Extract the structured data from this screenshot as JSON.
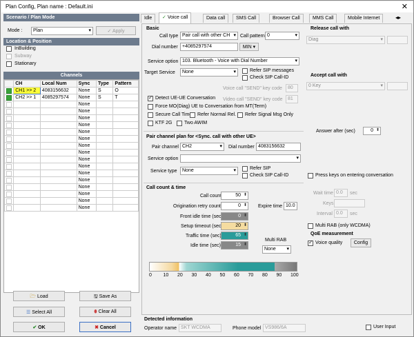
{
  "window": {
    "title": "Plan Config, Plan name : Default.ini",
    "close": "✕"
  },
  "left": {
    "section1": "Scenario / Plan Mode",
    "mode_label": "Mode :",
    "mode_value": "Plan",
    "apply": "Apply",
    "section2": "Location & Position",
    "location": [
      {
        "label": "InBuilding",
        "checked": false,
        "disabled": false
      },
      {
        "label": "Subway",
        "checked": false,
        "disabled": true
      },
      {
        "label": "Stationary",
        "checked": false,
        "disabled": false
      }
    ],
    "channels_title": "Channels",
    "columns": [
      "CH",
      "Local Num",
      "Sync",
      "Type",
      "Pattern"
    ],
    "rows": [
      {
        "checked": true,
        "ch": "CH1 >> 2",
        "num": "4083156632",
        "sync": "None",
        "type": "S",
        "pattern": "O",
        "highlight": true
      },
      {
        "checked": true,
        "ch": "CH2 >> 1",
        "num": "4085297574",
        "sync": "None",
        "type": "S",
        "pattern": "T",
        "highlight": false
      },
      {
        "checked": false,
        "ch": "",
        "num": "",
        "sync": "None",
        "type": "",
        "pattern": ""
      },
      {
        "checked": false,
        "ch": "",
        "num": "",
        "sync": "None",
        "type": "",
        "pattern": ""
      },
      {
        "checked": false,
        "ch": "",
        "num": "",
        "sync": "None",
        "type": "",
        "pattern": ""
      },
      {
        "checked": false,
        "ch": "",
        "num": "",
        "sync": "None",
        "type": "",
        "pattern": ""
      },
      {
        "checked": false,
        "ch": "",
        "num": "",
        "sync": "None",
        "type": "",
        "pattern": ""
      },
      {
        "checked": false,
        "ch": "",
        "num": "",
        "sync": "None",
        "type": "",
        "pattern": ""
      },
      {
        "checked": false,
        "ch": "",
        "num": "",
        "sync": "None",
        "type": "",
        "pattern": ""
      },
      {
        "checked": false,
        "ch": "",
        "num": "",
        "sync": "None",
        "type": "",
        "pattern": ""
      },
      {
        "checked": false,
        "ch": "",
        "num": "",
        "sync": "None",
        "type": "",
        "pattern": ""
      },
      {
        "checked": false,
        "ch": "",
        "num": "",
        "sync": "None",
        "type": "",
        "pattern": ""
      },
      {
        "checked": false,
        "ch": "",
        "num": "",
        "sync": "None",
        "type": "",
        "pattern": ""
      },
      {
        "checked": false,
        "ch": "",
        "num": "",
        "sync": "None",
        "type": "",
        "pattern": ""
      },
      {
        "checked": false,
        "ch": "",
        "num": "",
        "sync": "None",
        "type": "",
        "pattern": ""
      },
      {
        "checked": false,
        "ch": "",
        "num": "",
        "sync": "None",
        "type": "",
        "pattern": ""
      },
      {
        "checked": false,
        "ch": "",
        "num": "",
        "sync": "None",
        "type": "",
        "pattern": ""
      },
      {
        "checked": false,
        "ch": "",
        "num": "",
        "sync": "None",
        "type": "",
        "pattern": ""
      }
    ],
    "buttons": {
      "load": "Load",
      "save_as": "Save As",
      "select_all": "Select All",
      "clear_all": "Clear All",
      "ok": "OK",
      "cancel": "Cancel"
    }
  },
  "tabs": [
    "Idle",
    "Voice call",
    "Data call",
    "SMS Call",
    "Browser Call",
    "MMS Call",
    "Mobile Internet"
  ],
  "basic": {
    "title": "Basic",
    "call_type_label": "Call type",
    "call_type": "Pair call with other CH",
    "call_pattern_label": "Call pattern",
    "call_pattern": "0",
    "dial_label": "Dial number",
    "dial": "+4085297574",
    "min": "MIN ▾",
    "service_option_label": "Service option",
    "service_option": "103. Bluetooth - Voice with Dial Number",
    "target_label": "Target Service",
    "target": "None",
    "refer_sip_messages": "Refer SIP messages",
    "check_sip_callid": "Check SIP Call-ID",
    "voice_send_label": "Voice call \"SEND\" key code",
    "voice_send": "80",
    "video_send_label": "Video call \"SEND\" key code",
    "video_send": "81",
    "detect": "Detect UE-UE Conversation",
    "force": "Force MO(Diag) UE to Conversation from MT(Term)",
    "secure": "Secure Call Time",
    "refer_normal": "Refer Normal Rel.",
    "refer_signal": "Refer Signal Msg Only",
    "ktf": "KTF 2G",
    "two_awim": "Two AWIM"
  },
  "pair": {
    "title": "Pair channel plan for <Sync. call with other UE>",
    "pair_channel_label": "Pair channel",
    "pair_channel": "CH2",
    "dial_label": "Dial number",
    "dial": "4083156632",
    "service_option_label": "Service option",
    "service_type_label": "Service type",
    "service_type": "None",
    "refer_sip": "Refer SIP",
    "check_sip": "Check SIP Call-ID"
  },
  "count": {
    "title": "Call count & time",
    "call_count_label": "Call count",
    "call_count": "50",
    "retry_label": "Origination retry count",
    "retry": "0",
    "expire_label": "Expire time",
    "expire": "10.0",
    "front_idle_label": "Front idle time (sec)",
    "front_idle": "0",
    "setup_label": "Setup timeout (sec)",
    "setup": "20",
    "traffic_label": "Traffic time (sec)",
    "traffic": "65",
    "idle_label": "Idle time (sec)",
    "idle": "15",
    "multirab_label": "Multi RAB",
    "multirab": "None",
    "scale": [
      "0",
      "10",
      "20",
      "30",
      "40",
      "50",
      "60",
      "70",
      "80",
      "90",
      "100"
    ]
  },
  "release": {
    "title": "Release call with",
    "value": "Diag"
  },
  "accept": {
    "title": "Accept call with",
    "value": "0 Key",
    "answer_after_label": "Answer after (sec)",
    "answer_after": "0"
  },
  "keys": {
    "press_keys": "Press keys on entering conversation",
    "wait_label": "Wait time",
    "wait": "0.0",
    "wait_unit": "sec",
    "keys_label": "Keys",
    "interval_label": "Interval",
    "interval": "0.0",
    "interval_unit": "sec",
    "multi_rab": "Multi RAB (only WCDMA)"
  },
  "qoe": {
    "title": "QoE measurement",
    "voice_quality": "Voice quality",
    "config": "Config"
  },
  "detected": {
    "title": "Detected information",
    "operator_label": "Operator name",
    "operator": "SKT WCDMA",
    "phone_label": "Phone model",
    "phone": "VS986/6A",
    "user_input": "User Input"
  }
}
